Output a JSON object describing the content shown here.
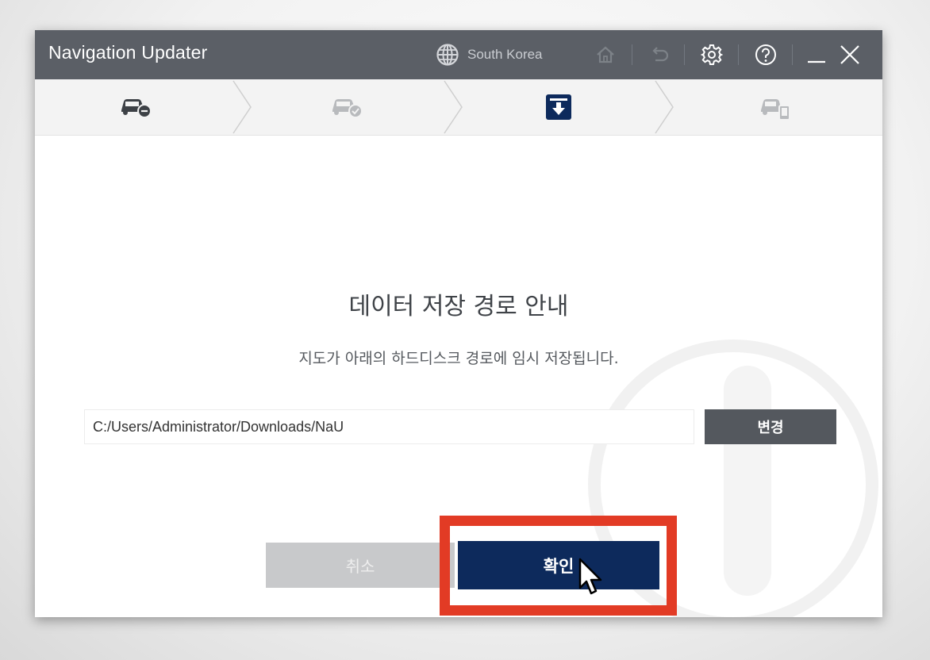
{
  "window": {
    "title": "Navigation Updater",
    "region_label": "South Korea"
  },
  "toolbar": {
    "icons": [
      "globe-icon",
      "home-icon",
      "undo-icon",
      "gear-icon",
      "help-icon",
      "minimize-icon",
      "close-icon"
    ]
  },
  "steps": [
    {
      "icon": "car-minus-icon",
      "state": "complete"
    },
    {
      "icon": "car-check-icon",
      "state": "inactive"
    },
    {
      "icon": "download-icon",
      "state": "active"
    },
    {
      "icon": "car-device-icon",
      "state": "inactive"
    }
  ],
  "dialog": {
    "heading": "데이터 저장 경로 안내",
    "description": "지도가 아래의 하드디스크 경로에 임시 저장됩니다.",
    "path_value": "C:/Users/Administrator/Downloads/NaU",
    "change_label": "변경",
    "cancel_label": "취소",
    "confirm_label": "확인"
  },
  "colors": {
    "titlebar": "#5b5f66",
    "accent": "#0d2a5c",
    "highlight": "#e23b25"
  }
}
